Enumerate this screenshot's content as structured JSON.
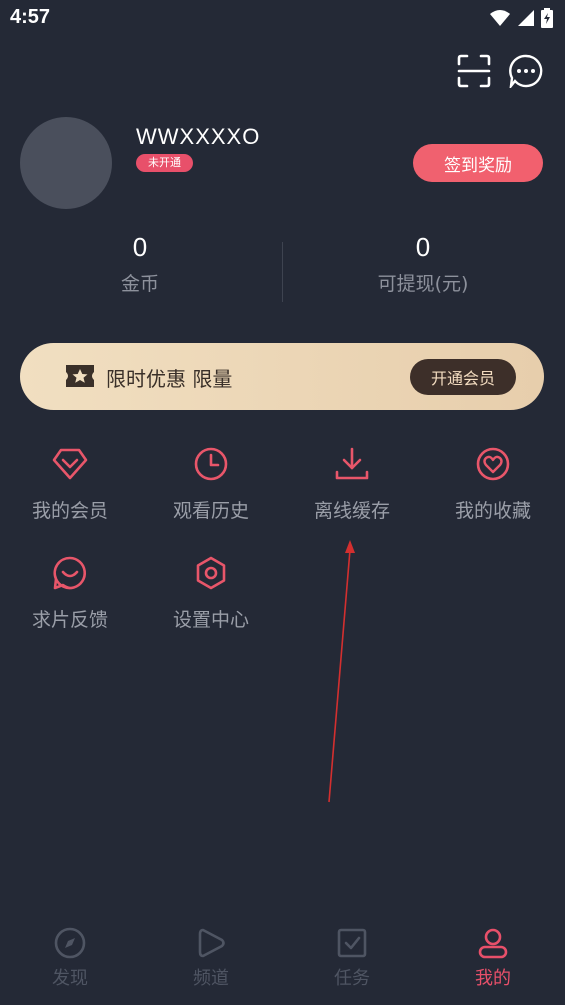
{
  "status_bar": {
    "time": "4:57",
    "icons": [
      "wifi-icon",
      "signal-icon",
      "battery-icon"
    ]
  },
  "header_actions": [
    "scan-icon",
    "message-icon"
  ],
  "profile": {
    "username": "WWXXXXO",
    "vip_status": "未开通",
    "signin_label": "签到奖励"
  },
  "stats": [
    {
      "value": "0",
      "label": "金币"
    },
    {
      "value": "0",
      "label": "可提现(元)"
    }
  ],
  "promo": {
    "text": "限时优惠 限量",
    "button": "开通会员",
    "icon": "vip-ticket-icon"
  },
  "menu": [
    {
      "label": "我的会员",
      "icon": "diamond-icon"
    },
    {
      "label": "观看历史",
      "icon": "clock-icon"
    },
    {
      "label": "离线缓存",
      "icon": "download-icon"
    },
    {
      "label": "我的收藏",
      "icon": "heart-icon"
    },
    {
      "label": "求片反馈",
      "icon": "feedback-icon"
    },
    {
      "label": "设置中心",
      "icon": "settings-icon"
    }
  ],
  "tabs": [
    {
      "label": "发现",
      "icon": "compass-icon",
      "active": false
    },
    {
      "label": "频道",
      "icon": "play-icon",
      "active": false
    },
    {
      "label": "任务",
      "icon": "task-icon",
      "active": false
    },
    {
      "label": "我的",
      "icon": "user-icon",
      "active": true
    }
  ],
  "colors": {
    "background": "#242936",
    "accent": "#e8506a",
    "icon_red": "#e8566a",
    "promo_gold": "#f1dfc1",
    "annotation_arrow": "#d32f2f"
  }
}
